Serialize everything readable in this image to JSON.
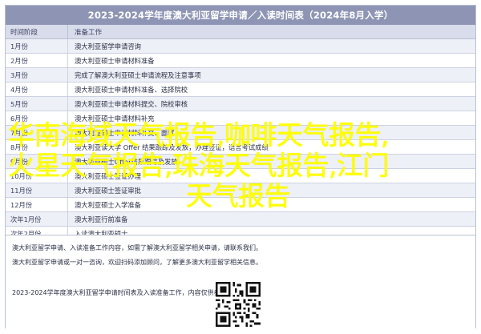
{
  "document": {
    "title": "2023-2024学年度澳大利亚留学申请／入读时间表（2024年8月入学）",
    "header": {
      "col_time": "时间阶段",
      "col_task": "准备工作"
    },
    "rows": [
      {
        "time": "1月份",
        "task": "澳大利亚留学申请咨询"
      },
      {
        "time": "2月份",
        "task": "澳大利亚硕士申请材料准备"
      },
      {
        "time": "3月份",
        "task": "完成了解澳大利亚硕士申请流程及注意事项"
      },
      {
        "time": "4月份",
        "task": "澳大利亚硕士申请材料准备、选择院校"
      },
      {
        "time": "5月份",
        "task": "澳大利亚硕士申请材料提交、院校审核"
      },
      {
        "time": "6月份",
        "task": "澳大利亚硕士申请材料补充"
      },
      {
        "time": "7月份",
        "task": "澳大利亚硕士申请材料补交、面试"
      },
      {
        "time": "8月份",
        "task": "澳大利亚读大学 Offer 结果跟踪及发放，办理签证，语言考试成绩"
      },
      {
        "time": "9月份",
        "task": "澳大利亚硕士Offer结果跟踪及发放"
      },
      {
        "time": "10月份",
        "task": "澳大利亚硕士签证办理"
      },
      {
        "time": "11月份",
        "task": "澳大利亚硕士签证审批"
      },
      {
        "time": "12月份",
        "task": "澳大利亚硕士入学准备"
      },
      {
        "time": "次年1月份",
        "task": "澳大利亚行前准备"
      },
      {
        "time": "次年2月份",
        "task": "入读澳大利亚硕士"
      }
    ],
    "footer_notes": [
      "澳大利亚留学申请、入读准备工作内容，如需了解澳大利亚留学相关申请，请联系我们。",
      "澳大利亚留学申请或一对一咨询，欢迎扫码添加顾问，了解更多澳大利亚留学相关信息。",
      "2023-2024学年度澳大利亚留学申请时间表及入读准备工作，内容仅供参考"
    ]
  },
  "overlay": {
    "line1": "华南海域天气报告,咖啡天气报告,",
    "line2": "火星天气报告,珠海天气报告,江门",
    "line3": "天气报告"
  },
  "colors": {
    "title_bar": "#8e95b4",
    "header_bg": "#d9dceb",
    "alt_row": "#eef0f7",
    "overlay_text": "#ffff00"
  },
  "icons": {
    "qr": "qr-code-icon"
  }
}
